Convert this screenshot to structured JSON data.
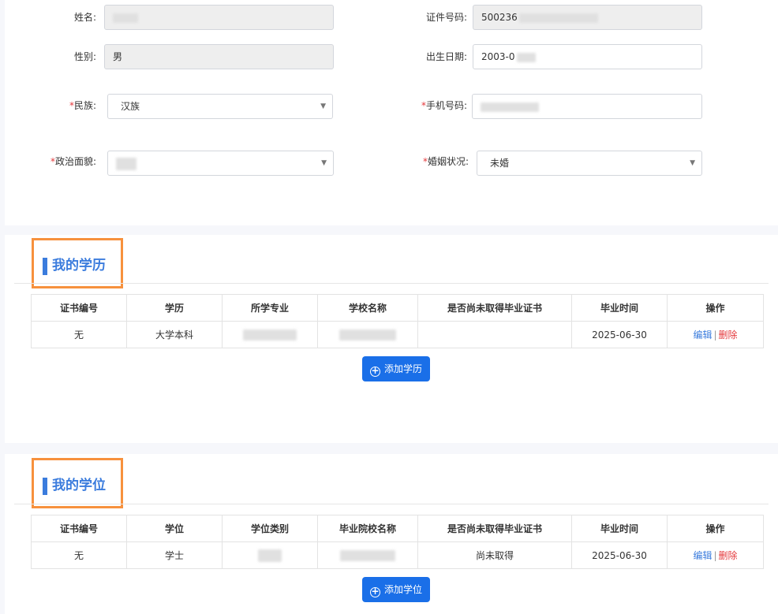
{
  "basic": {
    "name_label": "姓名:",
    "id_label": "证件号码:",
    "id_value": "500236",
    "gender_label": "性别:",
    "gender_value": "男",
    "birth_label": "出生日期:",
    "birth_value": "2003-0",
    "nation_label": "民族:",
    "nation_value": "汉族",
    "phone_label": "手机号码:",
    "political_label": "政治面貌:",
    "marital_label": "婚姻状况:",
    "marital_value": "未婚",
    "required_mark": "*"
  },
  "education": {
    "title": "我的学历",
    "headers": [
      "证书编号",
      "学历",
      "所学专业",
      "学校名称",
      "是否尚未取得毕业证书",
      "毕业时间",
      "操作"
    ],
    "rows": [
      {
        "cert_no": "无",
        "level": "大学本科",
        "major": "",
        "school": "",
        "not_obtained": "",
        "grad_date": "2025-06-30"
      }
    ],
    "edit_label": "编辑",
    "sep": "|",
    "delete_label": "删除",
    "add_label": "添加学历"
  },
  "degree": {
    "title": "我的学位",
    "headers": [
      "证书编号",
      "学位",
      "学位类别",
      "毕业院校名称",
      "是否尚未取得毕业证书",
      "毕业时间",
      "操作"
    ],
    "rows": [
      {
        "cert_no": "无",
        "level": "学士",
        "category": "",
        "school": "",
        "not_obtained": "尚未取得",
        "grad_date": "2025-06-30"
      }
    ],
    "edit_label": "编辑",
    "sep": "|",
    "delete_label": "删除",
    "add_label": "添加学位"
  },
  "colors": {
    "accent": "#3b7cdd",
    "highlight_border": "#f7913d",
    "button": "#1a6fe8",
    "danger": "#e4393c"
  },
  "icons": [
    "chevron-down-icon",
    "plus-circle-icon"
  ]
}
